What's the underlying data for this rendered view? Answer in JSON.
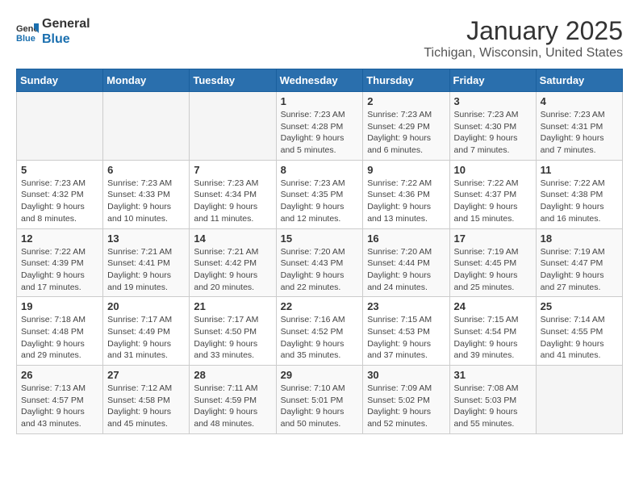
{
  "header": {
    "logo_general": "General",
    "logo_blue": "Blue",
    "month": "January 2025",
    "location": "Tichigan, Wisconsin, United States"
  },
  "days_of_week": [
    "Sunday",
    "Monday",
    "Tuesday",
    "Wednesday",
    "Thursday",
    "Friday",
    "Saturday"
  ],
  "weeks": [
    [
      {
        "day": "",
        "info": ""
      },
      {
        "day": "",
        "info": ""
      },
      {
        "day": "",
        "info": ""
      },
      {
        "day": "1",
        "info": "Sunrise: 7:23 AM\nSunset: 4:28 PM\nDaylight: 9 hours and 5 minutes."
      },
      {
        "day": "2",
        "info": "Sunrise: 7:23 AM\nSunset: 4:29 PM\nDaylight: 9 hours and 6 minutes."
      },
      {
        "day": "3",
        "info": "Sunrise: 7:23 AM\nSunset: 4:30 PM\nDaylight: 9 hours and 7 minutes."
      },
      {
        "day": "4",
        "info": "Sunrise: 7:23 AM\nSunset: 4:31 PM\nDaylight: 9 hours and 7 minutes."
      }
    ],
    [
      {
        "day": "5",
        "info": "Sunrise: 7:23 AM\nSunset: 4:32 PM\nDaylight: 9 hours and 8 minutes."
      },
      {
        "day": "6",
        "info": "Sunrise: 7:23 AM\nSunset: 4:33 PM\nDaylight: 9 hours and 10 minutes."
      },
      {
        "day": "7",
        "info": "Sunrise: 7:23 AM\nSunset: 4:34 PM\nDaylight: 9 hours and 11 minutes."
      },
      {
        "day": "8",
        "info": "Sunrise: 7:23 AM\nSunset: 4:35 PM\nDaylight: 9 hours and 12 minutes."
      },
      {
        "day": "9",
        "info": "Sunrise: 7:22 AM\nSunset: 4:36 PM\nDaylight: 9 hours and 13 minutes."
      },
      {
        "day": "10",
        "info": "Sunrise: 7:22 AM\nSunset: 4:37 PM\nDaylight: 9 hours and 15 minutes."
      },
      {
        "day": "11",
        "info": "Sunrise: 7:22 AM\nSunset: 4:38 PM\nDaylight: 9 hours and 16 minutes."
      }
    ],
    [
      {
        "day": "12",
        "info": "Sunrise: 7:22 AM\nSunset: 4:39 PM\nDaylight: 9 hours and 17 minutes."
      },
      {
        "day": "13",
        "info": "Sunrise: 7:21 AM\nSunset: 4:41 PM\nDaylight: 9 hours and 19 minutes."
      },
      {
        "day": "14",
        "info": "Sunrise: 7:21 AM\nSunset: 4:42 PM\nDaylight: 9 hours and 20 minutes."
      },
      {
        "day": "15",
        "info": "Sunrise: 7:20 AM\nSunset: 4:43 PM\nDaylight: 9 hours and 22 minutes."
      },
      {
        "day": "16",
        "info": "Sunrise: 7:20 AM\nSunset: 4:44 PM\nDaylight: 9 hours and 24 minutes."
      },
      {
        "day": "17",
        "info": "Sunrise: 7:19 AM\nSunset: 4:45 PM\nDaylight: 9 hours and 25 minutes."
      },
      {
        "day": "18",
        "info": "Sunrise: 7:19 AM\nSunset: 4:47 PM\nDaylight: 9 hours and 27 minutes."
      }
    ],
    [
      {
        "day": "19",
        "info": "Sunrise: 7:18 AM\nSunset: 4:48 PM\nDaylight: 9 hours and 29 minutes."
      },
      {
        "day": "20",
        "info": "Sunrise: 7:17 AM\nSunset: 4:49 PM\nDaylight: 9 hours and 31 minutes."
      },
      {
        "day": "21",
        "info": "Sunrise: 7:17 AM\nSunset: 4:50 PM\nDaylight: 9 hours and 33 minutes."
      },
      {
        "day": "22",
        "info": "Sunrise: 7:16 AM\nSunset: 4:52 PM\nDaylight: 9 hours and 35 minutes."
      },
      {
        "day": "23",
        "info": "Sunrise: 7:15 AM\nSunset: 4:53 PM\nDaylight: 9 hours and 37 minutes."
      },
      {
        "day": "24",
        "info": "Sunrise: 7:15 AM\nSunset: 4:54 PM\nDaylight: 9 hours and 39 minutes."
      },
      {
        "day": "25",
        "info": "Sunrise: 7:14 AM\nSunset: 4:55 PM\nDaylight: 9 hours and 41 minutes."
      }
    ],
    [
      {
        "day": "26",
        "info": "Sunrise: 7:13 AM\nSunset: 4:57 PM\nDaylight: 9 hours and 43 minutes."
      },
      {
        "day": "27",
        "info": "Sunrise: 7:12 AM\nSunset: 4:58 PM\nDaylight: 9 hours and 45 minutes."
      },
      {
        "day": "28",
        "info": "Sunrise: 7:11 AM\nSunset: 4:59 PM\nDaylight: 9 hours and 48 minutes."
      },
      {
        "day": "29",
        "info": "Sunrise: 7:10 AM\nSunset: 5:01 PM\nDaylight: 9 hours and 50 minutes."
      },
      {
        "day": "30",
        "info": "Sunrise: 7:09 AM\nSunset: 5:02 PM\nDaylight: 9 hours and 52 minutes."
      },
      {
        "day": "31",
        "info": "Sunrise: 7:08 AM\nSunset: 5:03 PM\nDaylight: 9 hours and 55 minutes."
      },
      {
        "day": "",
        "info": ""
      }
    ]
  ]
}
